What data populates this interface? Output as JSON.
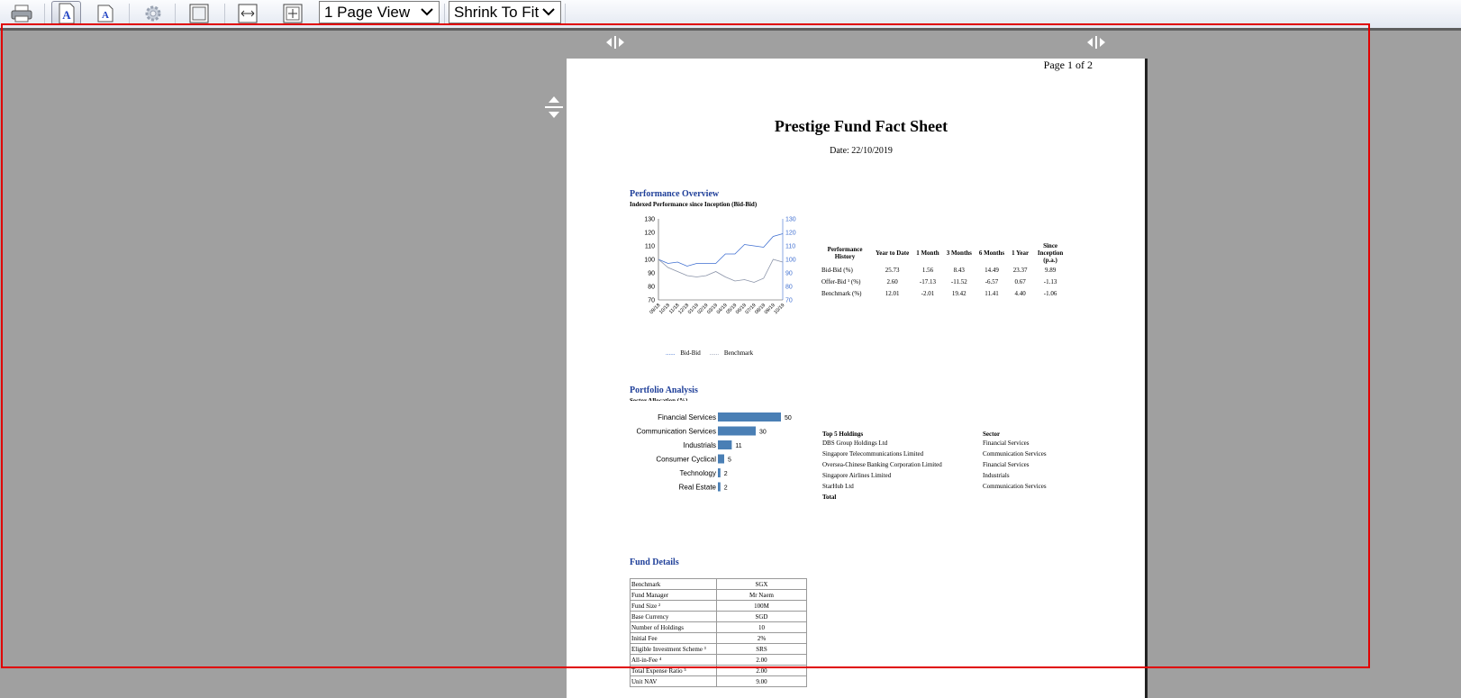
{
  "toolbar": {
    "view_select": "1 Page View",
    "zoom_select": "Shrink To Fit",
    "icons": [
      "printer-icon",
      "single-page-icon",
      "text-size-icon",
      "settings-gear-icon",
      "page-view-icon",
      "fit-width-icon",
      "fit-page-icon"
    ]
  },
  "report": {
    "page_indicator": "Page 1 of 2",
    "title": "Prestige Fund Fact Sheet",
    "date": "Date: 22/10/2019",
    "performance": {
      "heading": "Performance Overview",
      "subheading": "Indexed Performance since Inception (Bid-Bid)",
      "columns": [
        "Performance History",
        "Year to Date",
        "1 Month",
        "3 Months",
        "6 Months",
        "1 Year",
        "Since Inception (p.a.)"
      ],
      "rows": [
        [
          "Bid-Bid (%)",
          "25.73",
          "1.56",
          "8.43",
          "14.49",
          "23.37",
          "9.89"
        ],
        [
          "Offer-Bid ¹ (%)",
          "2.60",
          "-17.13",
          "-11.52",
          "-6.57",
          "0.67",
          "-1.13"
        ],
        [
          "Benchmark (%)",
          "12.01",
          "-2.01",
          "19.42",
          "11.41",
          "4.40",
          "-1.06"
        ]
      ]
    },
    "portfolio": {
      "heading": "Portfolio Analysis",
      "subheading": "Sector Allocation (%)",
      "holdings_header": [
        "Top 5 Holdings",
        "Sector"
      ],
      "holdings": [
        [
          "DBS Group Holdings Ltd",
          "Financial Services"
        ],
        [
          "Singapore Telecommunications Limited",
          "Communication Services"
        ],
        [
          "Oversea-Chinese Banking Corporation Limited",
          "Financial Services"
        ],
        [
          "Singapore Airlines Limited",
          "Industrials"
        ],
        [
          "StarHub Ltd",
          "Communication Services"
        ]
      ],
      "holdings_total": "Total"
    },
    "details": {
      "heading": "Fund Details",
      "rows": [
        [
          "Benchmark",
          "SGX"
        ],
        [
          "Fund Manager",
          "Mr Naem"
        ],
        [
          "Fund Size ²",
          "100M"
        ],
        [
          "Base Currency",
          "SGD"
        ],
        [
          "Number of Holdings",
          "10"
        ],
        [
          "Initial Fee",
          "2%"
        ],
        [
          "Eligible Investment Scheme ³",
          "SRS"
        ],
        [
          "All-in-Fee ⁴",
          "2.00"
        ],
        [
          "Total Expense Ratio ⁵",
          "2.00"
        ],
        [
          "Unit NAV",
          "9.00"
        ]
      ]
    }
  },
  "chart_data": [
    {
      "type": "line",
      "x": [
        "09/18",
        "10/18",
        "11/18",
        "12/18",
        "01/19",
        "02/19",
        "03/19",
        "04/19",
        "05/19",
        "06/19",
        "07/19",
        "08/19",
        "09/19",
        "10/19"
      ],
      "series": [
        {
          "name": "Bid-Bid",
          "values": [
            100,
            97,
            98,
            95,
            97,
            97,
            97,
            104,
            104,
            111,
            110,
            109,
            117,
            119
          ]
        },
        {
          "name": "Benchmark",
          "values": [
            100,
            94,
            91,
            88,
            87,
            88,
            91,
            87,
            84,
            85,
            83,
            86,
            100,
            98
          ]
        }
      ],
      "ylim": [
        70,
        130
      ],
      "yticks": [
        70,
        80,
        90,
        100,
        110,
        120,
        130
      ],
      "legend": "bottom",
      "colors": {
        "Bid-Bid": "#3f6fd1",
        "Benchmark": "#8a93a8"
      }
    },
    {
      "type": "bar",
      "orientation": "horizontal",
      "categories": [
        "Financial Services",
        "Communication Services",
        "Industrials",
        "Consumer Cyclical",
        "Technology",
        "Real Estate"
      ],
      "values": [
        50,
        30,
        11,
        5,
        2,
        2
      ],
      "color": "#4a7fb5"
    }
  ]
}
